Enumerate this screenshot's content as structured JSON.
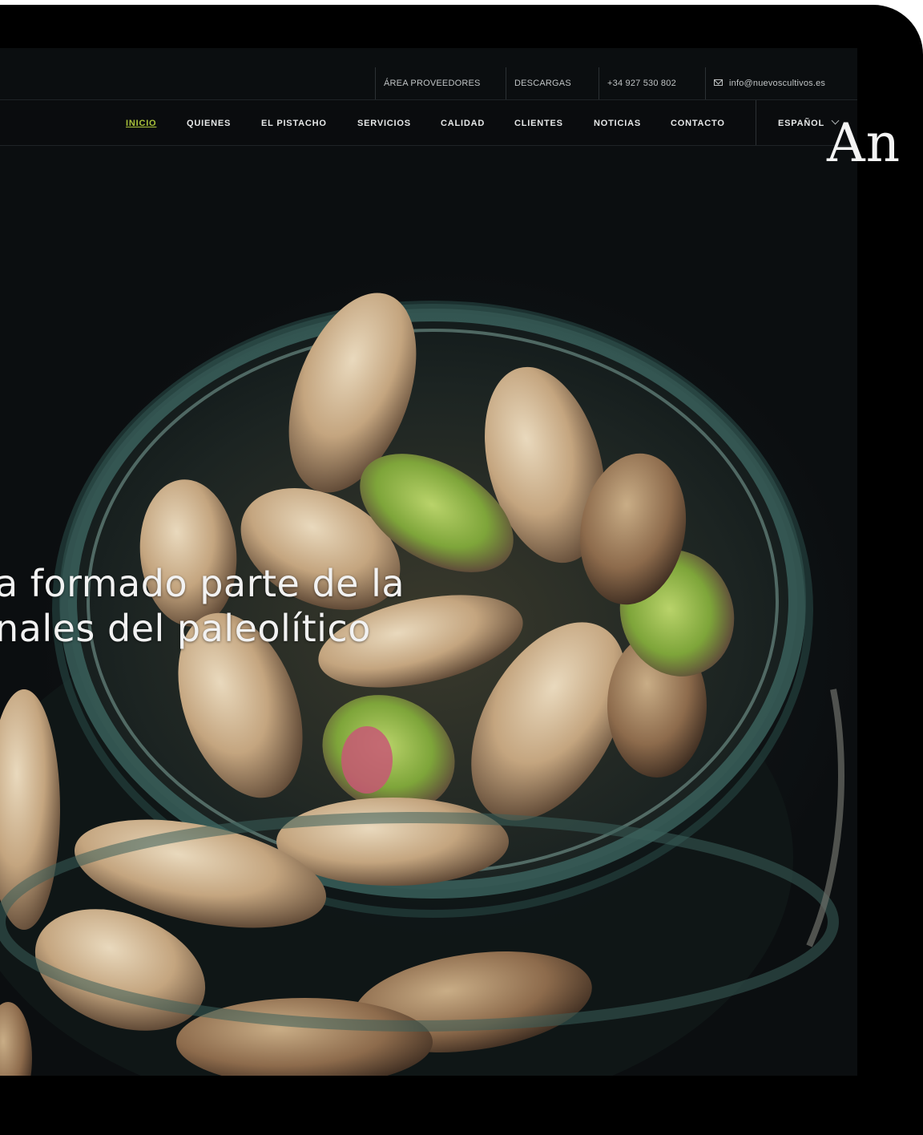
{
  "topbar": {
    "items": [
      "ÁREA PROVEEDORES",
      "DESCARGAS",
      "+34 927 530 802",
      "info@nuevoscultivos.es"
    ]
  },
  "nav": {
    "items": [
      "INICIO",
      "QUIENES",
      "EL PISTACHO",
      "SERVICIOS",
      "CALIDAD",
      "CLIENTES",
      "NOTICIAS",
      "CONTACTO"
    ],
    "active": "INICIO",
    "language": "ESPAÑOL"
  },
  "hero": {
    "line1": "a formado parte de la",
    "line2": "nales del paleolítico"
  },
  "side_title": "An",
  "colors": {
    "accent": "#a8c13a",
    "background": "#0b0e10"
  },
  "icons": [
    "mail-icon",
    "chevron-down-icon"
  ]
}
